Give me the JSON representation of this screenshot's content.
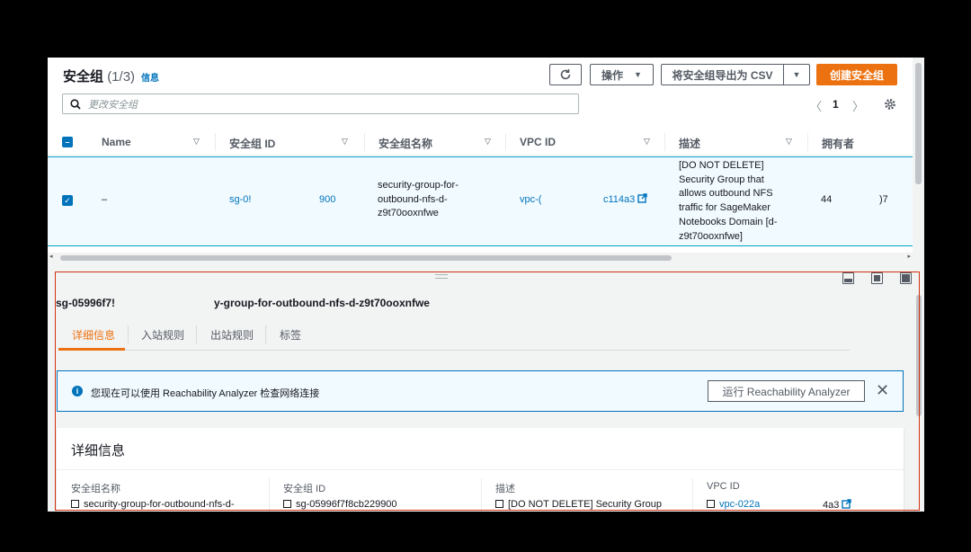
{
  "header": {
    "title": "安全组",
    "count": "(1/3)",
    "info_link": "信息",
    "actions_label": "操作",
    "export_label": "将安全组导出为 CSV",
    "create_label": "创建安全组"
  },
  "search": {
    "placeholder": "更改安全组"
  },
  "pager": {
    "page": "1"
  },
  "table": {
    "columns": [
      "Name",
      "安全组 ID",
      "安全组名称",
      "VPC ID",
      "描述",
      "拥有者"
    ],
    "row": {
      "name": "–",
      "sg_id_a": "sg-0!",
      "sg_id_b": "900",
      "sg_name": [
        "security-group-for-",
        "outbound-nfs-d-",
        "z9t70ooxnfwe"
      ],
      "vpc_a": "vpc-(",
      "vpc_b": "c114a3",
      "description": [
        "[DO NOT DELETE]",
        "Security Group that",
        "allows outbound NFS",
        "traffic for SageMaker",
        "Notebooks Domain [d-",
        "z9t70ooxnfwe]"
      ],
      "owner_a": "44",
      "owner_b": ")7"
    }
  },
  "detail": {
    "sg_title_a": "sg-05996f7!",
    "sg_title_b": "y-group-for-outbound-nfs-d-z9t70ooxnfwe",
    "tabs": [
      "详细信息",
      "入站规则",
      "出站规则",
      "标签"
    ],
    "alert_text": "您现在可以使用 Reachability Analyzer 检查网络连接",
    "alert_button": "运行 Reachability Analyzer",
    "card_title": "详细信息",
    "fields": [
      {
        "key": "安全组名称",
        "value": "security-group-for-outbound-nfs-d-"
      },
      {
        "key": "安全组 ID",
        "value": "sg-05996f7f8cb229900"
      },
      {
        "key": "描述",
        "value": "[DO NOT DELETE] Security Group"
      },
      {
        "key": "VPC ID",
        "value_a": "vpc-022a",
        "value_b": "4a3"
      }
    ]
  },
  "colors": {
    "accent": "#ec7211",
    "link": "#0073bb",
    "highlight": "#d13212"
  }
}
